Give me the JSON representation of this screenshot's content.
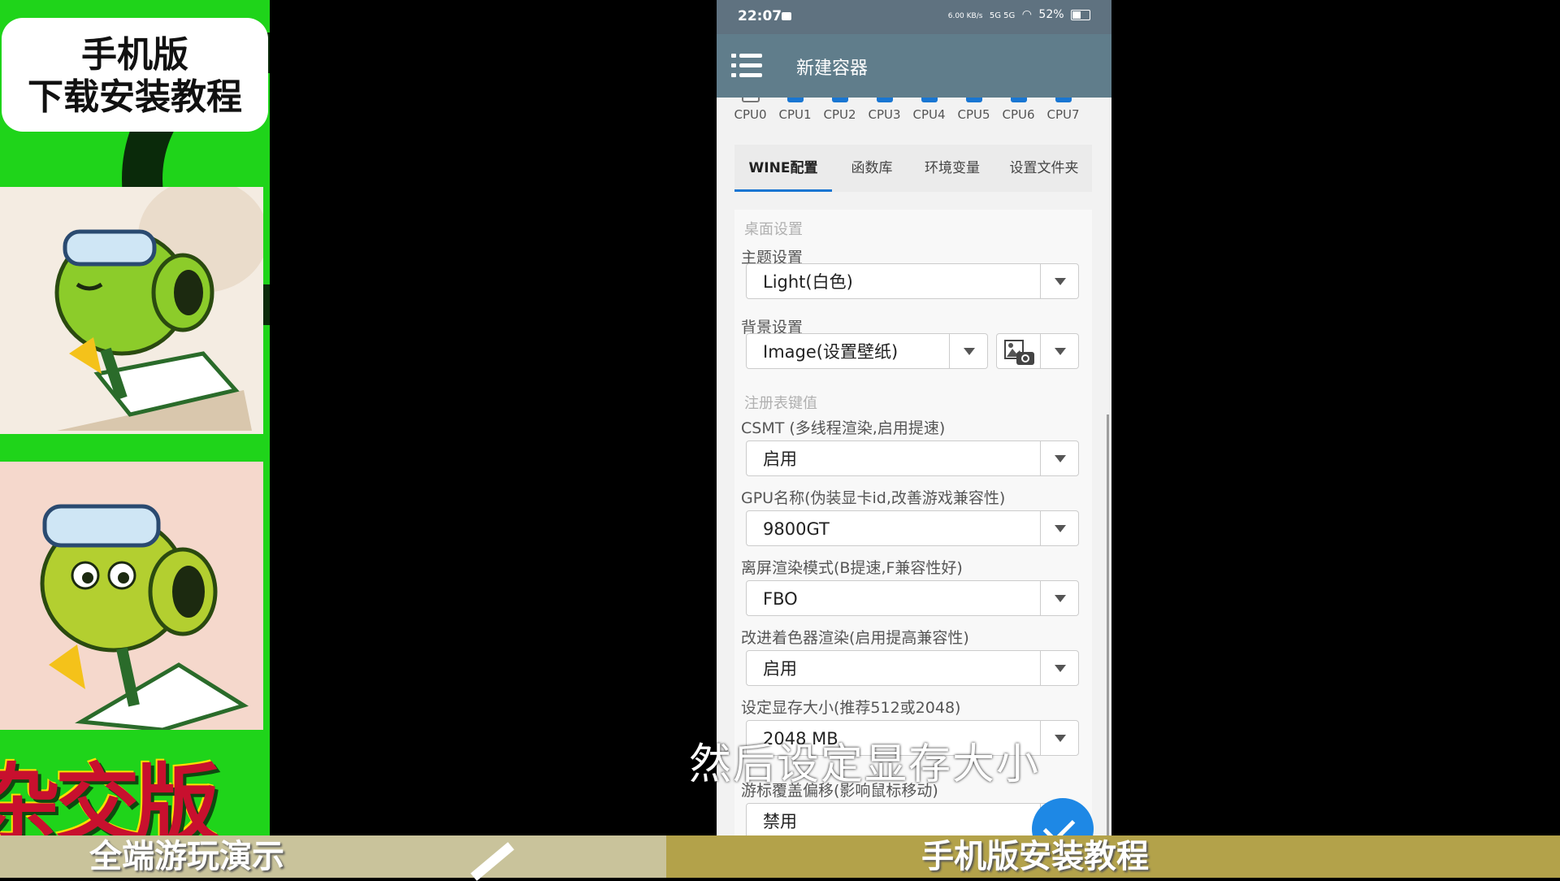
{
  "promo": {
    "title_line1": "手机版",
    "title_line2": "下载安装教程",
    "logo_text": "杂交版"
  },
  "bottom_banner": {
    "left_text": "全端游玩演示",
    "right_text": "手机版安装教程"
  },
  "subtitle": "然后设定显存大小",
  "status_bar": {
    "time": "22:07",
    "net_speed": "6.00 KB/s",
    "signal": "5G 5G",
    "battery": "52%"
  },
  "app_bar": {
    "title": "新建容器"
  },
  "cpu": [
    {
      "label": "CPU0",
      "checked": false
    },
    {
      "label": "CPU1",
      "checked": true
    },
    {
      "label": "CPU2",
      "checked": true
    },
    {
      "label": "CPU3",
      "checked": true
    },
    {
      "label": "CPU4",
      "checked": true
    },
    {
      "label": "CPU5",
      "checked": true
    },
    {
      "label": "CPU6",
      "checked": true
    },
    {
      "label": "CPU7",
      "checked": true
    }
  ],
  "tabs": [
    {
      "label": "WINE配置",
      "active": true
    },
    {
      "label": "函数库",
      "active": false
    },
    {
      "label": "环境变量",
      "active": false
    },
    {
      "label": "设置文件夹",
      "active": false
    }
  ],
  "desktop_section": {
    "header": "桌面设置",
    "theme_label": "主题设置",
    "theme_value": "Light(白色)",
    "background_label": "背景设置",
    "background_value": "Image(设置壁纸)"
  },
  "registry_section": {
    "header": "注册表键值",
    "csmt_label": "CSMT (多线程渲染,启用提速)",
    "csmt_value": "启用",
    "gpu_label": "GPU名称(伪装显卡id,改善游戏兼容性)",
    "gpu_value": "9800GT",
    "offscreen_label": "离屏渲染模式(B提速,F兼容性好)",
    "offscreen_value": "FBO",
    "shader_label": "改进着色器渲染(启用提高兼容性)",
    "shader_value": "启用",
    "vram_label": "设定显存大小(推荐512或2048)",
    "vram_value": "2048 MB",
    "cursor_label": "游标覆盖偏移(影响鼠标移动)",
    "cursor_value": "禁用"
  },
  "colors": {
    "app_bar": "#607d8b",
    "accent": "#1976d2",
    "fab": "#1e88e5"
  }
}
